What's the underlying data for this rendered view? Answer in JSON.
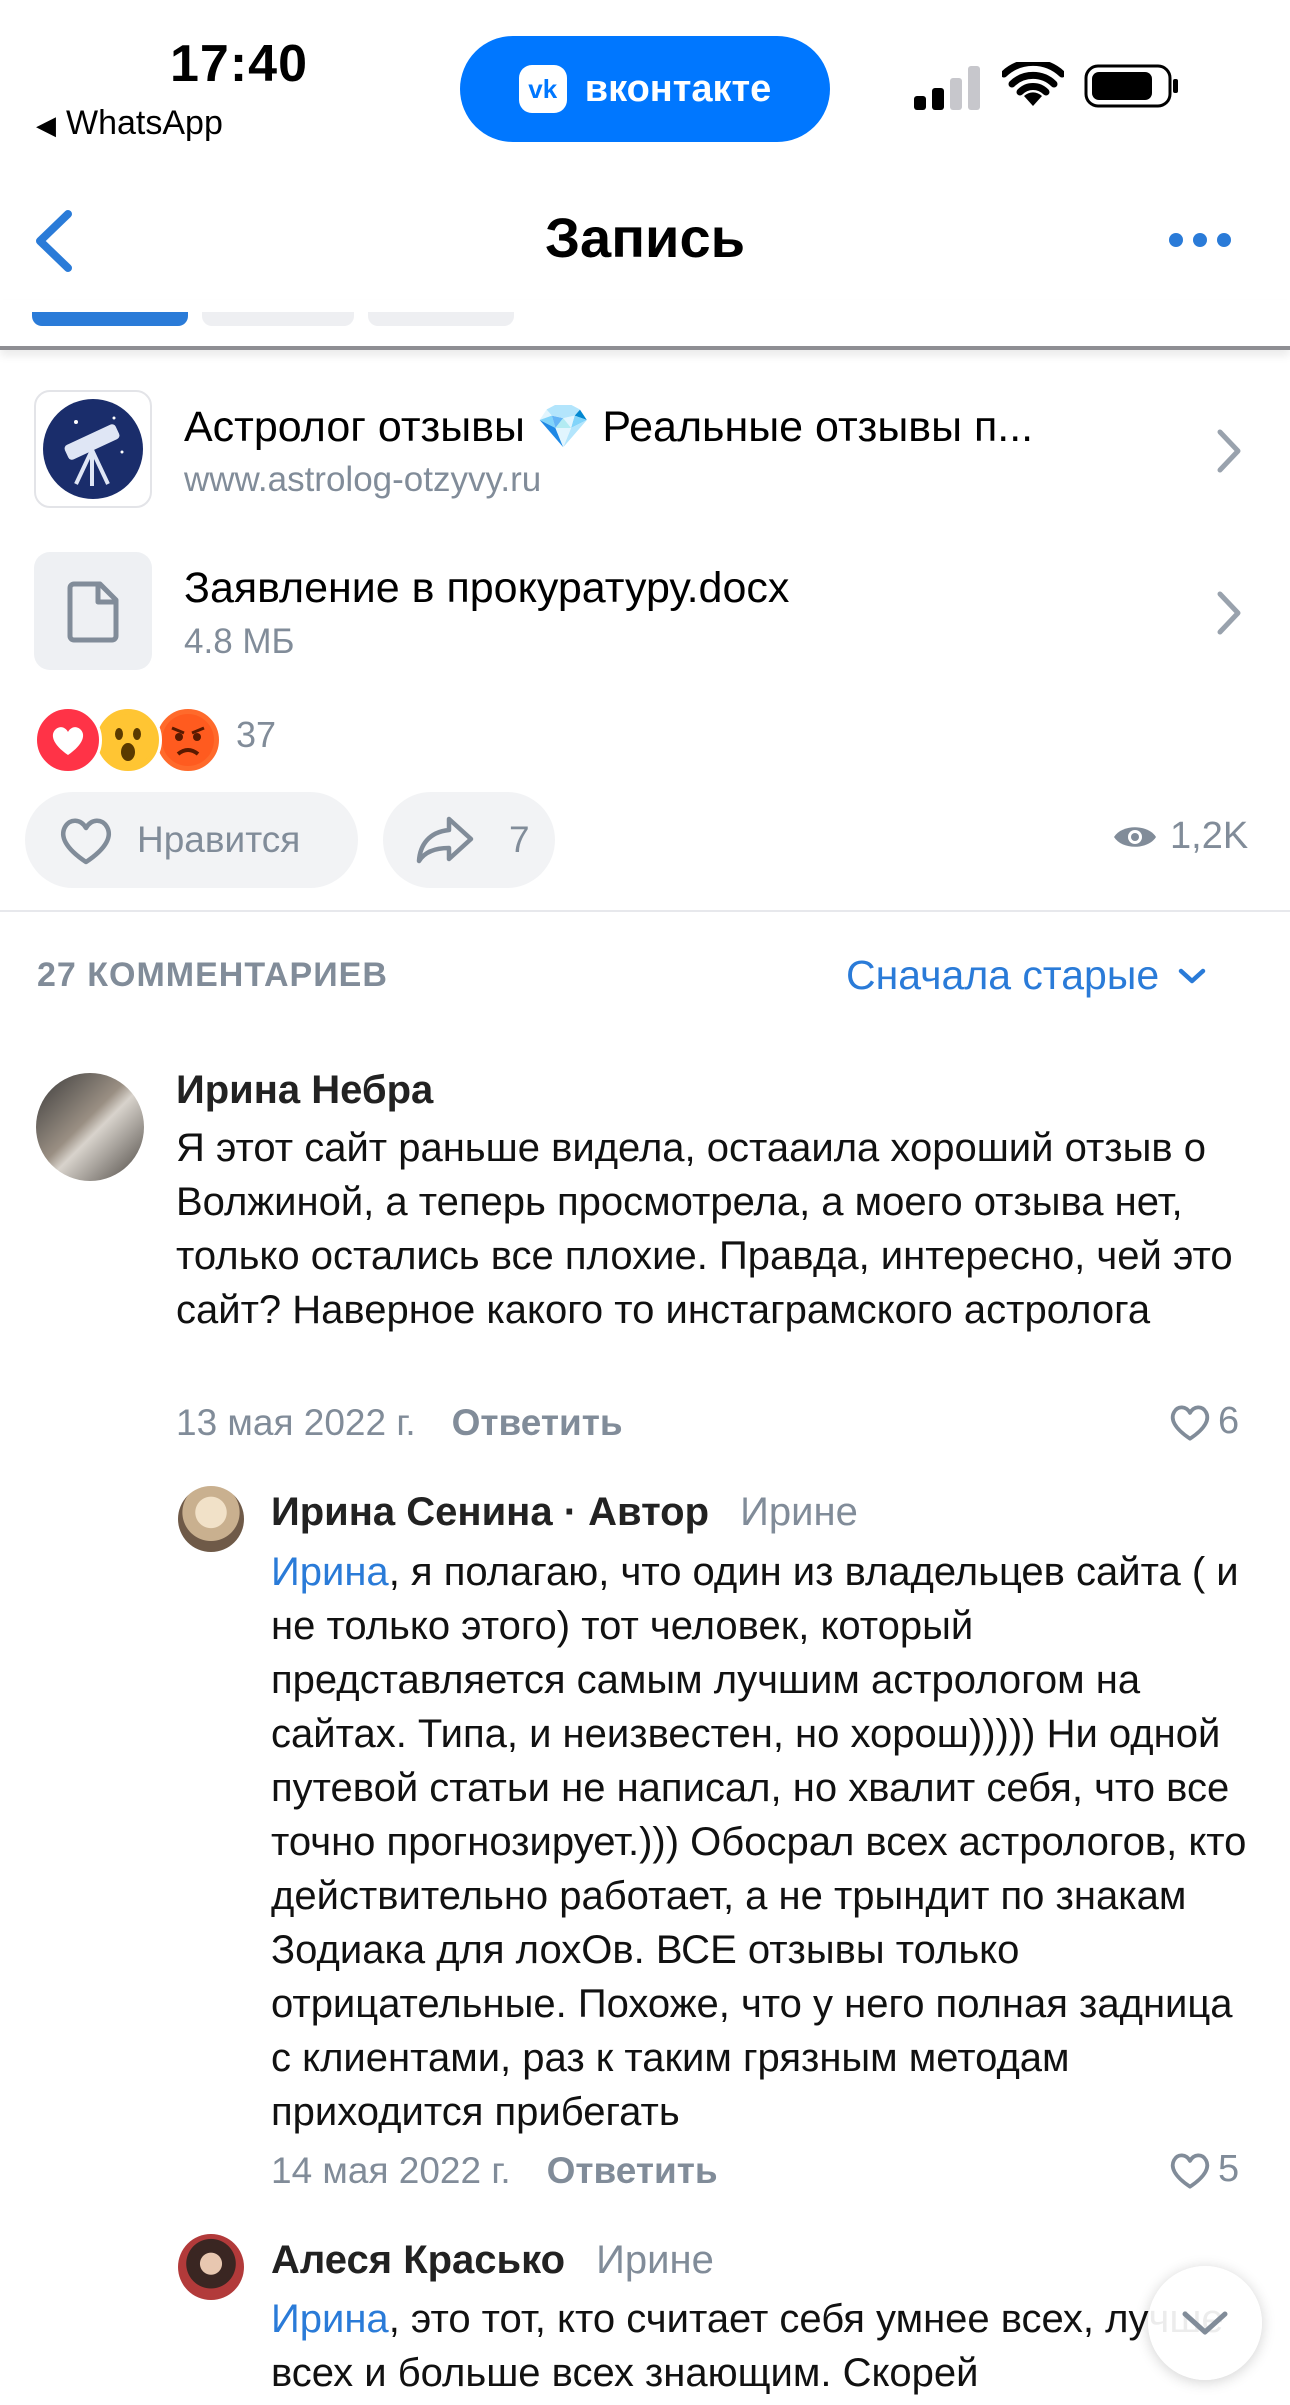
{
  "status_bar": {
    "time": "17:40",
    "back_app": "WhatsApp",
    "pill_label": "вконтакте",
    "pill_logo": "vk"
  },
  "nav": {
    "title": "Запись"
  },
  "attachments": [
    {
      "title": "Астролог отзывы 💎 Реальные отзывы п...",
      "subtitle": "www.astrolog-otzyvy.ru"
    },
    {
      "title": "Заявление в прокуратуру.docx",
      "subtitle": "4.8 МБ"
    }
  ],
  "reactions": {
    "icons": [
      "heart",
      "surprised-face",
      "angry-face"
    ],
    "count": "37"
  },
  "actions": {
    "like_label": "Нравится",
    "share_count": "7",
    "views": "1,2K"
  },
  "comments_header": {
    "count_label": "27 КОММЕНТАРИЕВ",
    "sort_label": "Сначала старые"
  },
  "comments": [
    {
      "author": "Ирина Небра",
      "text": "Я этот сайт раньше видела, остааила хороший отзыв о Волжиной, а теперь просмотрела, а моего отзыва нет, только остались все плохие. Правда, интересно, чей это сайт? Наверное какого то инстаграмского астролога",
      "date": "13 мая 2022 г.",
      "reply_label": "Ответить",
      "likes": "6"
    },
    {
      "author": "Ирина Сенина · Автор",
      "reply_to": "Ирине",
      "mention": "Ирина",
      "text": ", я полагаю, что один из владельцев сайта ( и не только этого) тот человек, который представляется самым лучшим астрологом на сайтах. Типа, и неизвестен, но хорош))))) Ни одной путевой статьи не написал, но хвалит себя, что все точно прогнозирует.))) Обосрал всех астрологов, кто действительно работает, а не трындит по знакам Зодиака для лохОв. ВСЕ отзывы только отрицательные. Похоже, что у него полная задница с клиентами, раз к таким грязным методам приходится прибегать",
      "date": "14 мая 2022 г.",
      "reply_label": "Ответить",
      "likes": "5"
    },
    {
      "author": "Алеся Красько",
      "reply_to": "Ирине",
      "mention": "Ирина",
      "text": ", это тот, кто считает себя умнее всех, лучше всех и больше всех знающим. Скорей"
    }
  ],
  "colors": {
    "accent": "#2a7bd8",
    "vk_blue": "#0077ff",
    "secondary_text": "#818c99"
  }
}
